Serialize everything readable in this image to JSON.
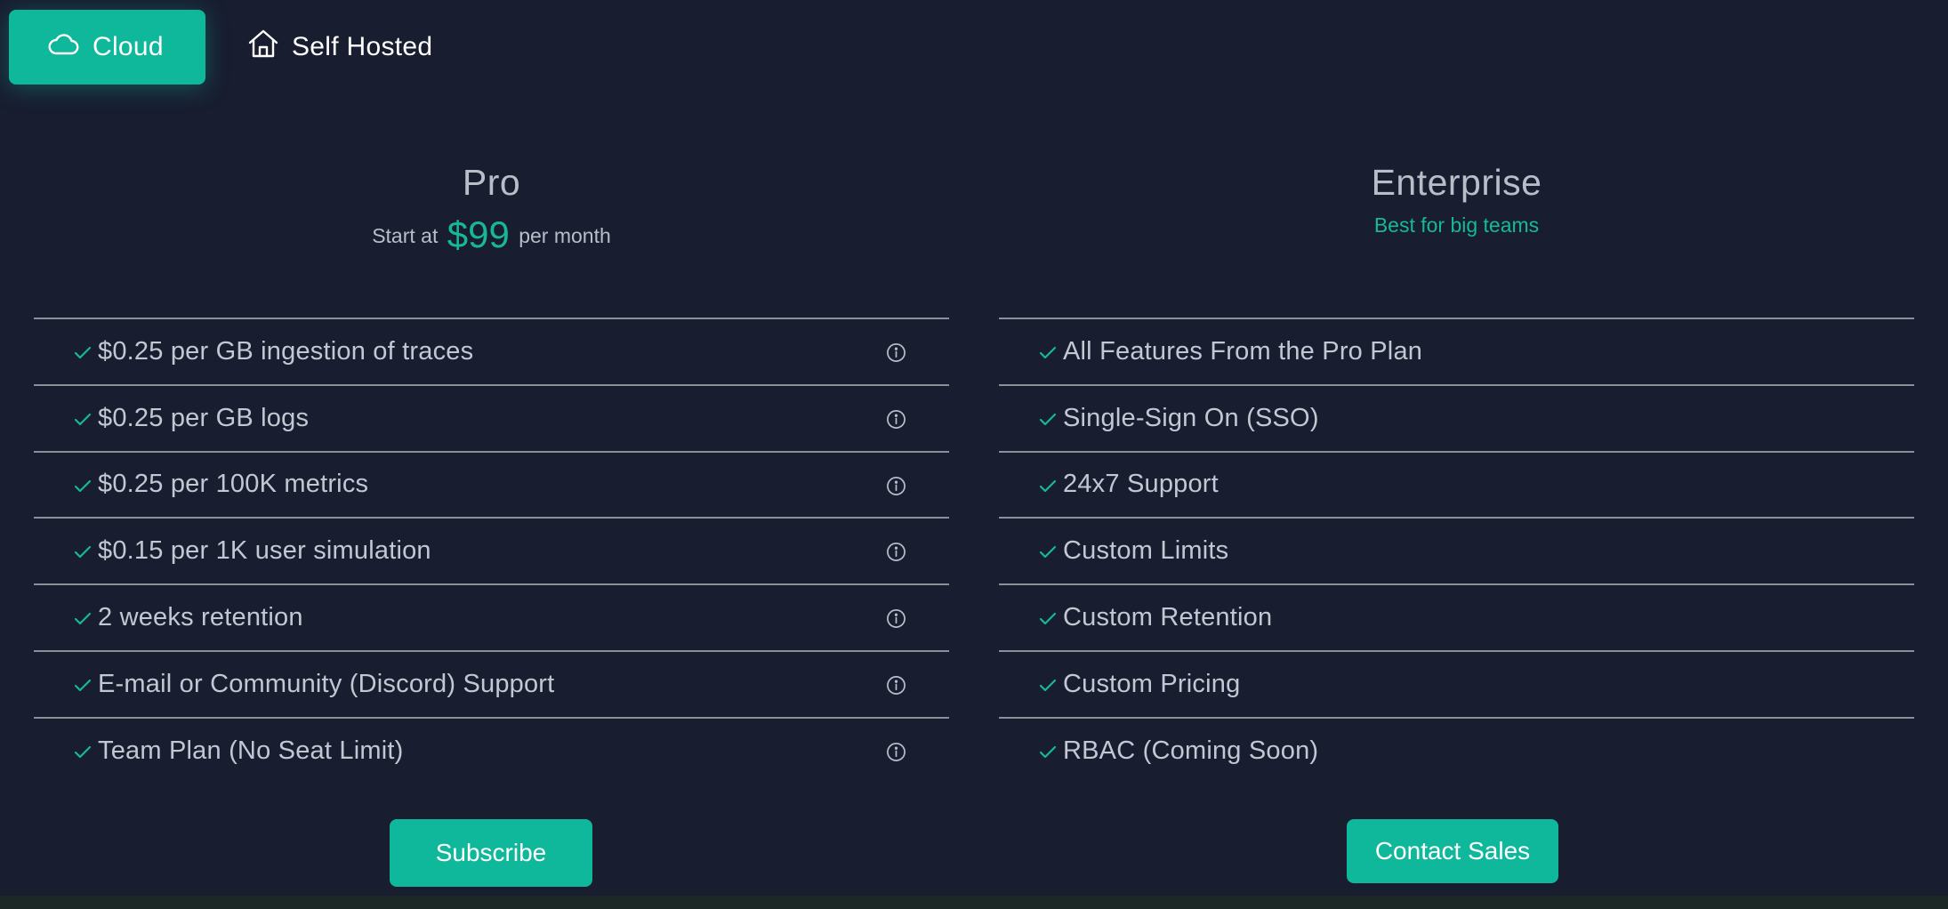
{
  "tabs": [
    {
      "label": "Cloud",
      "icon": "cloud-icon",
      "active": true
    },
    {
      "label": "Self Hosted",
      "icon": "house-icon",
      "active": false
    }
  ],
  "colors": {
    "accent": "#0fb89b",
    "accent_text": "#17b897",
    "background": "#181d30",
    "text": "#c3c7d2",
    "divider": "#8c8f97"
  },
  "plans": {
    "pro": {
      "title": "Pro",
      "price_prefix": "Start at",
      "price_amount": "$99",
      "price_suffix": "per month",
      "features": [
        {
          "text": "$0.25 per GB ingestion of traces",
          "icon": "check-icon",
          "info_icon": "info-icon"
        },
        {
          "text": "$0.25 per GB logs",
          "icon": "check-icon",
          "info_icon": "info-icon"
        },
        {
          "text": "$0.25 per 100K metrics",
          "icon": "check-icon",
          "info_icon": "info-icon"
        },
        {
          "text": "$0.15 per 1K user simulation",
          "icon": "check-icon",
          "info_icon": "info-icon"
        },
        {
          "text": "2 weeks retention",
          "icon": "check-icon",
          "info_icon": "info-icon"
        },
        {
          "text": "E-mail or Community (Discord) Support",
          "icon": "check-icon",
          "info_icon": "info-icon"
        },
        {
          "text": "Team Plan (No Seat Limit)",
          "icon": "check-icon",
          "info_icon": "info-icon"
        }
      ],
      "cta_label": "Subscribe"
    },
    "enterprise": {
      "title": "Enterprise",
      "subtitle": "Best for big teams",
      "features": [
        {
          "text": "All Features From the Pro Plan",
          "icon": "check-icon"
        },
        {
          "text": "Single-Sign On (SSO)",
          "icon": "check-icon"
        },
        {
          "text": "24x7 Support",
          "icon": "check-icon"
        },
        {
          "text": "Custom Limits",
          "icon": "check-icon"
        },
        {
          "text": "Custom Retention",
          "icon": "check-icon"
        },
        {
          "text": "Custom Pricing",
          "icon": "check-icon"
        },
        {
          "text": "RBAC (Coming Soon)",
          "icon": "check-icon"
        }
      ],
      "cta_label": "Contact Sales"
    }
  }
}
